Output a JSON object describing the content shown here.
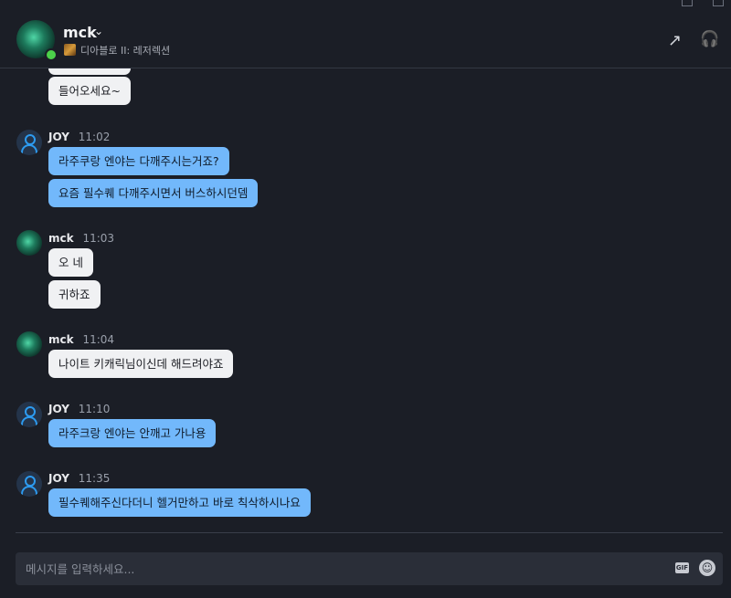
{
  "header": {
    "name": "mck",
    "game": "디아블로 II: 레저렉션"
  },
  "messages": {
    "group0": {
      "bubble": "들어오세요~"
    },
    "group1": {
      "name": "JOY",
      "time": "11:02",
      "bubbles": [
        "라주쿠랑 엔야는 다깨주시는거죠?",
        "요즘 필수퀘 다깨주시면서 버스하시던뎀"
      ]
    },
    "group2": {
      "name": "mck",
      "time": "11:03",
      "bubbles": [
        "오 네",
        "귀하죠"
      ]
    },
    "group3": {
      "name": "mck",
      "time": "11:04",
      "bubbles": [
        "나이트 키캐릭님이신데 해드려야죠"
      ]
    },
    "group4": {
      "name": "JOY",
      "time": "11:10",
      "bubbles": [
        "라주크랑 엔야는 안깨고 가나용"
      ]
    },
    "group5": {
      "name": "JOY",
      "time": "11:35",
      "bubbles": [
        "필수퀘해주신다더니 헬거만하고 바로 칙삭하시나요"
      ]
    }
  },
  "composer": {
    "placeholder": "메시지를 입력하세요...",
    "gif_label": "GIF"
  },
  "colors": {
    "background": "#1b1e26",
    "my_bubble": "#f0f1f3",
    "their_bubble": "#72b8fb",
    "online": "#4cd14a"
  },
  "icons": [
    "chevron-down-icon",
    "game-icon",
    "expand-icon",
    "headset-icon",
    "person-icon",
    "gif-icon",
    "emoji-icon"
  ]
}
